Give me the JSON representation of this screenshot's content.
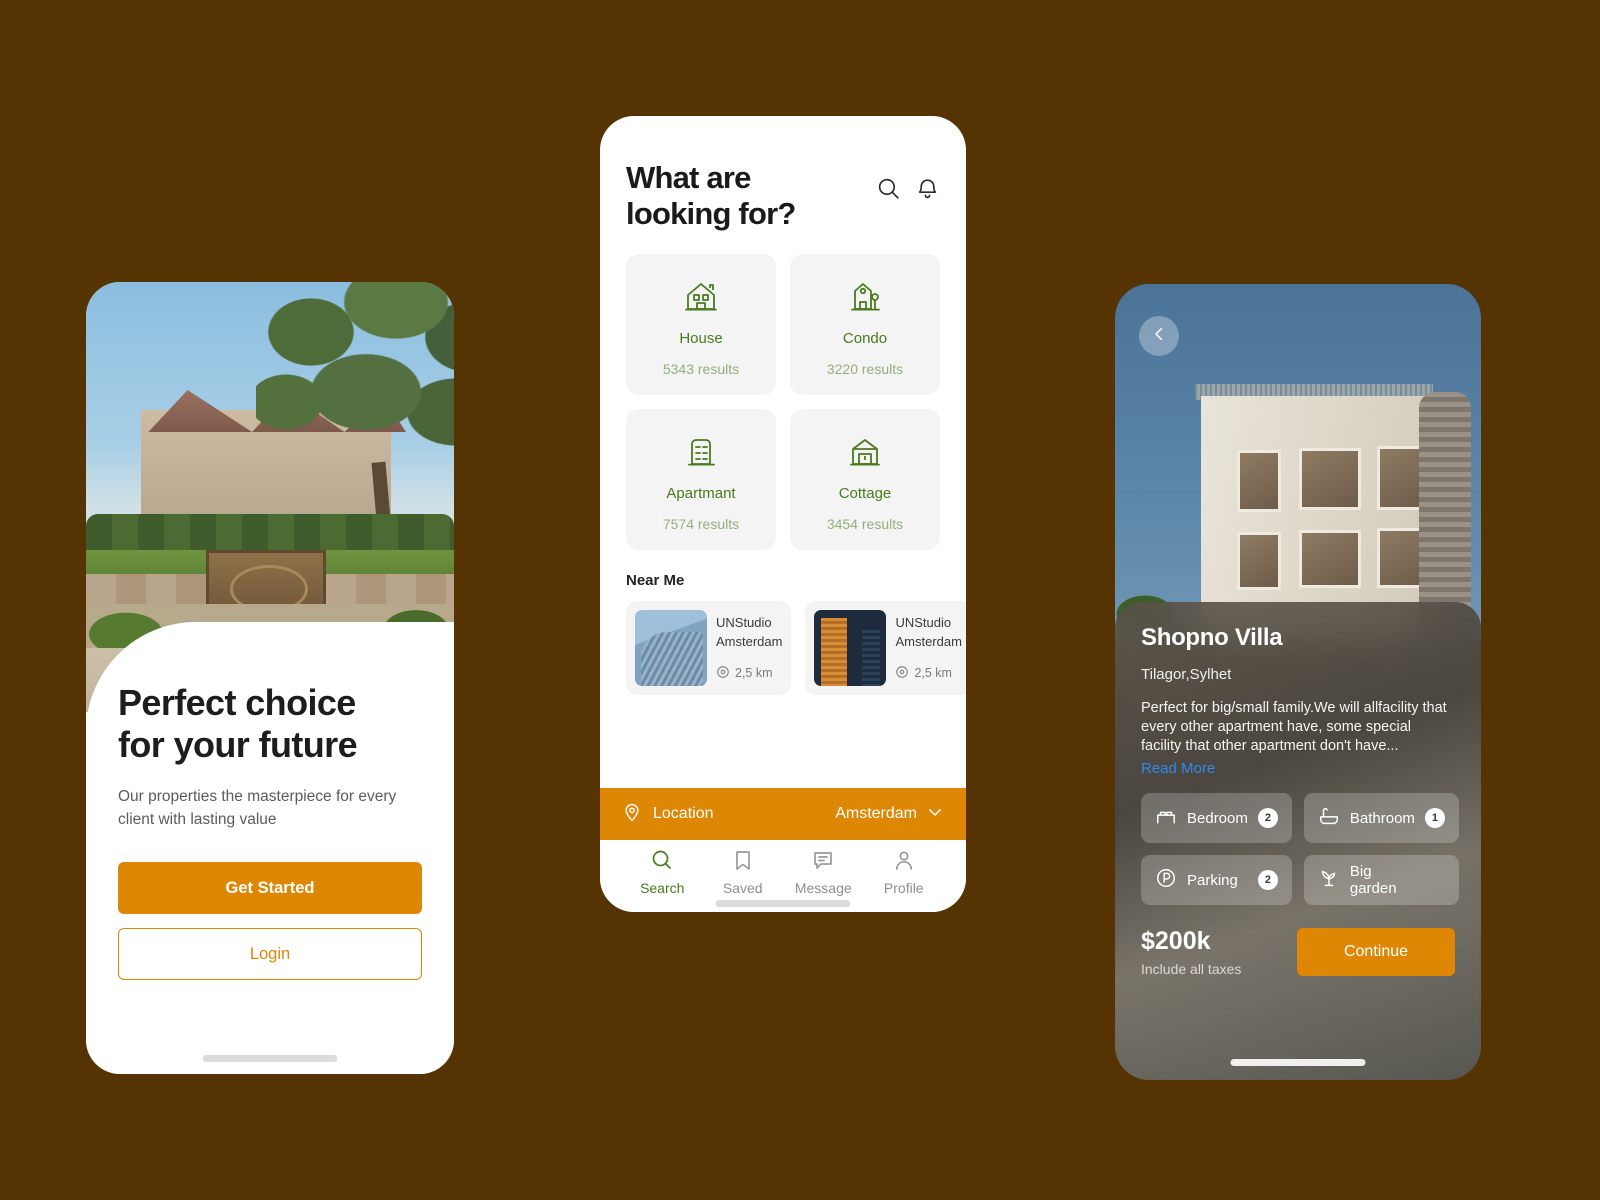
{
  "background_color": "#563303",
  "accent_orange": "#DD8704",
  "accent_green": "#4A7A1E",
  "link_blue": "#2E8BE8",
  "onboarding": {
    "headline_line1": "Perfect choice",
    "headline_line2": "for your future",
    "subcopy": "Our properties the masterpiece for every client with lasting value",
    "primary_button": "Get Started",
    "secondary_button": "Login",
    "hero_image_alt": "suburban house with garden and wooden gate"
  },
  "search": {
    "title_line1": "What are",
    "title_line2": "looking for?",
    "icons": [
      "search-icon",
      "bell-icon"
    ],
    "categories": [
      {
        "label": "House",
        "count": "5343 results",
        "icon": "house-icon"
      },
      {
        "label": "Condo",
        "count": "3220 results",
        "icon": "condo-icon"
      },
      {
        "label": "Apartmant",
        "count": "7574 results",
        "icon": "apartment-icon"
      },
      {
        "label": "Cottage",
        "count": "3454 results",
        "icon": "cottage-icon"
      }
    ],
    "near_me_title": "Near Me",
    "near_me": [
      {
        "name": "UNStudio Amsterdam",
        "distance": "2,5 km",
        "thumb": "glass-office-building"
      },
      {
        "name": "UNStudio Amsterdam",
        "distance": "2,5 km",
        "thumb": "orange-skyscraper"
      }
    ],
    "location_bar": {
      "label": "Location",
      "value": "Amsterdam",
      "pin_icon": "location-pin-icon",
      "chevron_icon": "chevron-down-icon"
    },
    "tabs": [
      {
        "label": "Search",
        "icon": "search-icon",
        "active": true
      },
      {
        "label": "Saved",
        "icon": "bookmark-icon",
        "active": false
      },
      {
        "label": "Message",
        "icon": "message-icon",
        "active": false
      },
      {
        "label": "Profile",
        "icon": "person-icon",
        "active": false
      }
    ]
  },
  "detail": {
    "back_icon": "chevron-left-icon",
    "photo_alt": "modern white apartment building with wood cladding",
    "title": "Shopno Villa",
    "location": "Tilagor,Sylhet",
    "description": "Perfect for big/small family.We will allfacility that every other apartment have, some special facility that other apartment don't have...",
    "read_more": "Read More",
    "features": [
      {
        "label": "Bedroom",
        "count": "2",
        "icon": "bed-icon"
      },
      {
        "label": "Bathroom",
        "count": "1",
        "icon": "bathtub-icon"
      },
      {
        "label": "Parking",
        "count": "2",
        "icon": "parking-icon"
      },
      {
        "label": "Big garden",
        "count": "",
        "icon": "plant-icon"
      }
    ],
    "price": "$200k",
    "price_note": "Include all taxes",
    "continue_button": "Continue"
  }
}
